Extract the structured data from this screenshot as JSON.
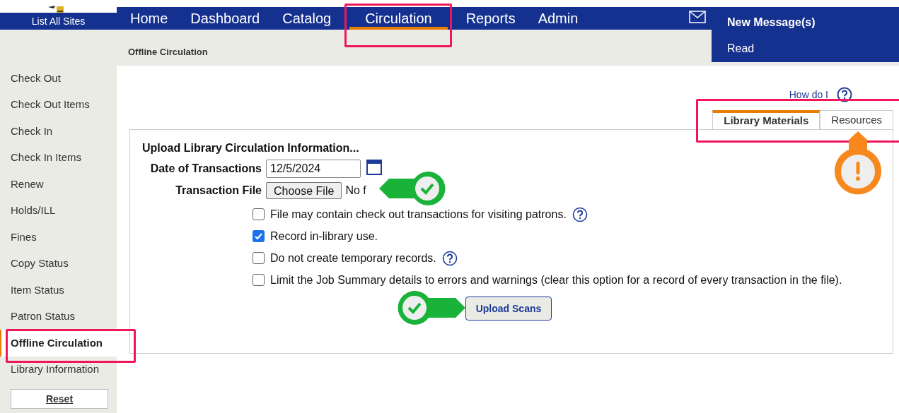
{
  "header": {
    "site_link": "List All Sites",
    "nav": [
      {
        "label": "Home",
        "selected": false
      },
      {
        "label": "Dashboard",
        "selected": false
      },
      {
        "label": "Catalog",
        "selected": false
      },
      {
        "label": "Circulation",
        "selected": true
      },
      {
        "label": "Reports",
        "selected": false
      },
      {
        "label": "Admin",
        "selected": false
      }
    ],
    "messages": {
      "title": "New Message(s)",
      "action": "Read"
    },
    "breadcrumb": "Offline Circulation"
  },
  "sidebar": {
    "items": [
      {
        "label": "Check Out",
        "selected": false
      },
      {
        "label": "Check Out Items",
        "selected": false
      },
      {
        "label": "Check In",
        "selected": false
      },
      {
        "label": "Check In Items",
        "selected": false
      },
      {
        "label": "Renew",
        "selected": false
      },
      {
        "label": "Holds/ILL",
        "selected": false
      },
      {
        "label": "Fines",
        "selected": false
      },
      {
        "label": "Copy Status",
        "selected": false
      },
      {
        "label": "Item Status",
        "selected": false
      },
      {
        "label": "Patron Status",
        "selected": false
      },
      {
        "label": "Offline Circulation",
        "selected": true
      },
      {
        "label": "Library Information",
        "selected": false
      }
    ],
    "reset_button": "Reset"
  },
  "help_link": "How do I",
  "tabs": [
    {
      "label": "Library Materials",
      "selected": true
    },
    {
      "label": "Resources",
      "selected": false
    }
  ],
  "form": {
    "heading": "Upload Library Circulation Information...",
    "date_label": "Date of Transactions",
    "date_value": "12/5/2024",
    "file_label": "Transaction File",
    "file_button": "Choose File",
    "file_status": "No f",
    "options": [
      {
        "label": "File may contain check out transactions for visiting patrons.",
        "checked": false,
        "help": true
      },
      {
        "label": "Record in-library use.",
        "checked": true,
        "help": false
      },
      {
        "label": "Do not create temporary records.",
        "checked": false,
        "help": true
      },
      {
        "label": "Limit the Job Summary details to errors and warnings (clear this option for a record of every transaction in the file).",
        "checked": false,
        "help": false
      }
    ],
    "submit": "Upload Scans"
  }
}
